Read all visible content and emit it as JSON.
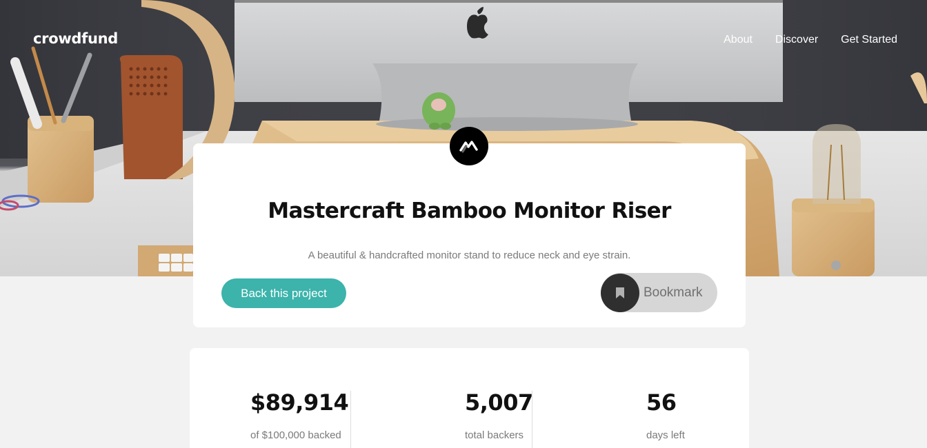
{
  "header": {
    "logo": "crowdfund",
    "nav": [
      "About",
      "Discover",
      "Get Started"
    ]
  },
  "project": {
    "title": "Mastercraft Bamboo Monitor Riser",
    "description": "A beautiful & handcrafted monitor stand to reduce neck and eye strain.",
    "back_label": "Back this project",
    "bookmark_label": "Bookmark"
  },
  "stats": {
    "backed_amount": "$89,914",
    "backed_caption": "of $100,000 backed",
    "backers": "5,007",
    "backers_caption": "total backers",
    "days": "56",
    "days_caption": "days left"
  },
  "colors": {
    "accent": "#3cb3ab",
    "page_bg": "#f2f2f2",
    "card_bg": "#ffffff",
    "bookmark_bg": "#d6d6d6"
  },
  "icons": [
    "apple-logo-icon",
    "mastercraft-logo-icon",
    "bookmark-icon"
  ]
}
